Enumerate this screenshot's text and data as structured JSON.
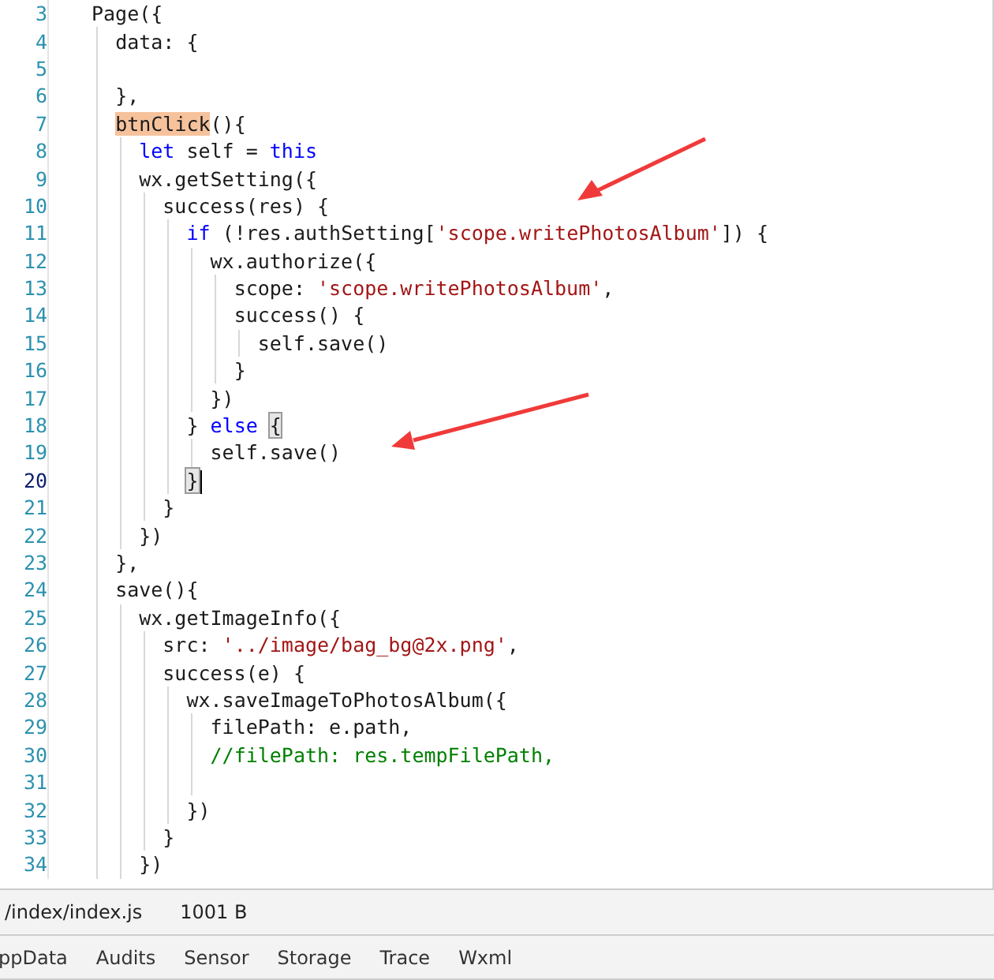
{
  "editor": {
    "lines": [
      {
        "number": "3",
        "current": false,
        "tokens": [
          {
            "text": "Page({",
            "kind": "plain"
          }
        ]
      },
      {
        "number": "4",
        "current": false,
        "tokens": [
          {
            "text": "  data: {",
            "kind": "plain"
          }
        ]
      },
      {
        "number": "5",
        "current": false
      },
      {
        "number": "6",
        "current": false,
        "tokens": [
          {
            "text": "  },",
            "kind": "plain"
          }
        ]
      },
      {
        "number": "7",
        "current": false,
        "tokens": [
          {
            "text": "  btnClick",
            "kind": "highlight"
          },
          {
            "text": "(){",
            "kind": "plain"
          }
        ]
      },
      {
        "number": "8",
        "current": false,
        "tokens": [
          {
            "text": "    let",
            "kind": "keyword"
          },
          {
            "text": " self = ",
            "kind": "plain"
          },
          {
            "text": "this",
            "kind": "keyword"
          }
        ]
      },
      {
        "number": "9",
        "current": false,
        "tokens": [
          {
            "text": "    wx.getSetting({",
            "kind": "plain"
          }
        ]
      },
      {
        "number": "10",
        "current": false,
        "tokens": [
          {
            "text": "      success(res) {",
            "kind": "plain"
          }
        ]
      },
      {
        "number": "11",
        "current": false,
        "tokens": [
          {
            "text": "        if",
            "kind": "keyword"
          },
          {
            "text": " (!res.authSetting[",
            "kind": "plain"
          },
          {
            "text": "'scope.writePhotosAlbum'",
            "kind": "string"
          },
          {
            "text": "]) {",
            "kind": "plain"
          }
        ]
      },
      {
        "number": "12",
        "current": false,
        "tokens": [
          {
            "text": "          wx.authorize({",
            "kind": "plain"
          }
        ]
      },
      {
        "number": "13",
        "current": false,
        "tokens": [
          {
            "text": "            scope: ",
            "kind": "plain"
          },
          {
            "text": "'scope.writePhotosAlbum'",
            "kind": "string"
          },
          {
            "text": ",",
            "kind": "plain"
          }
        ]
      },
      {
        "number": "14",
        "current": false,
        "tokens": [
          {
            "text": "            success() {",
            "kind": "plain"
          }
        ]
      },
      {
        "number": "15",
        "current": false,
        "tokens": [
          {
            "text": "              self.save()",
            "kind": "plain"
          }
        ]
      },
      {
        "number": "16",
        "current": false,
        "tokens": [
          {
            "text": "            }",
            "kind": "plain"
          }
        ]
      },
      {
        "number": "17",
        "current": false,
        "tokens": [
          {
            "text": "          })",
            "kind": "plain"
          }
        ]
      },
      {
        "number": "18",
        "current": false,
        "tokens": [
          {
            "text": "        } ",
            "kind": "plain"
          },
          {
            "text": "else ",
            "kind": "keyword"
          },
          {
            "text": "{",
            "kind": "match"
          }
        ]
      },
      {
        "number": "19",
        "current": false,
        "tokens": [
          {
            "text": "          self.save()",
            "kind": "plain"
          }
        ]
      },
      {
        "number": "20",
        "current": true,
        "tokens": [
          {
            "text": "        }",
            "kind": "match"
          }
        ]
      },
      {
        "number": "21",
        "current": false,
        "tokens": [
          {
            "text": "      }",
            "kind": "plain"
          }
        ]
      },
      {
        "number": "22",
        "current": false,
        "tokens": [
          {
            "text": "    })",
            "kind": "plain"
          }
        ]
      },
      {
        "number": "23",
        "current": false,
        "tokens": [
          {
            "text": "  },",
            "kind": "plain"
          }
        ]
      },
      {
        "number": "24",
        "current": false,
        "tokens": [
          {
            "text": "  save(){",
            "kind": "plain"
          }
        ]
      },
      {
        "number": "25",
        "current": false,
        "tokens": [
          {
            "text": "    wx.getImageInfo({",
            "kind": "plain"
          }
        ]
      },
      {
        "number": "26",
        "current": false,
        "tokens": [
          {
            "text": "      src: ",
            "kind": "plain"
          },
          {
            "text": "'../image/bag_bg@2x.png'",
            "kind": "string"
          },
          {
            "text": ",",
            "kind": "plain"
          }
        ]
      },
      {
        "number": "27",
        "current": false,
        "tokens": [
          {
            "text": "      success(e) {",
            "kind": "plain"
          }
        ]
      },
      {
        "number": "28",
        "current": false,
        "tokens": [
          {
            "text": "        wx.saveImageToPhotosAlbum({",
            "kind": "plain"
          }
        ]
      },
      {
        "number": "29",
        "current": false,
        "tokens": [
          {
            "text": "          filePath: e.path,",
            "kind": "plain"
          }
        ]
      },
      {
        "number": "30",
        "current": false,
        "tokens": [
          {
            "text": "          //filePath: res.tempFilePath,",
            "kind": "comment"
          }
        ]
      },
      {
        "number": "31",
        "current": false
      },
      {
        "number": "32",
        "current": false,
        "tokens": [
          {
            "text": "        })",
            "kind": "plain"
          }
        ]
      },
      {
        "number": "33",
        "current": false,
        "tokens": [
          {
            "text": "      }",
            "kind": "plain"
          }
        ]
      },
      {
        "number": "34",
        "current": false,
        "tokens": [
          {
            "text": "    })",
            "kind": "plain"
          }
        ]
      }
    ]
  },
  "status_bar": {
    "file_path": "/index/index.js",
    "file_size": "1001 B"
  },
  "devtools_tabs": [
    {
      "label": "ppData"
    },
    {
      "label": "Audits"
    },
    {
      "label": "Sensor"
    },
    {
      "label": "Storage"
    },
    {
      "label": "Trace"
    },
    {
      "label": "Wxml"
    }
  ]
}
